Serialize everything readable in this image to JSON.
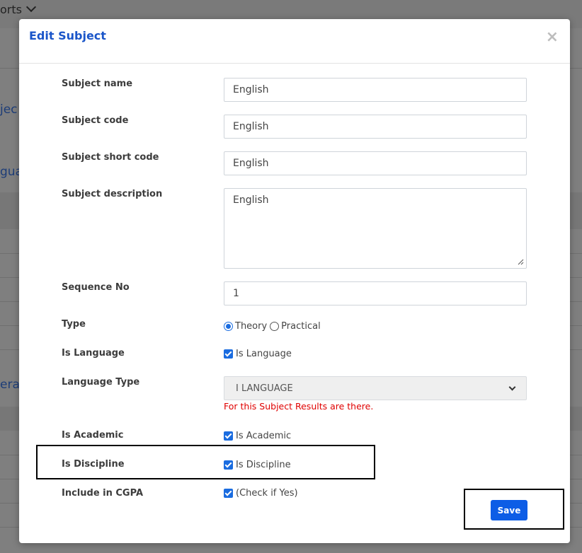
{
  "background": {
    "nav_text": "orts",
    "left_fragments": [
      "jec",
      "gua",
      "era"
    ]
  },
  "modal": {
    "title": "Edit Subject",
    "close_glyph": "×"
  },
  "form": {
    "subject_name": {
      "label": "Subject name",
      "value": "English"
    },
    "subject_code": {
      "label": "Subject code",
      "value": "English"
    },
    "subject_short_code": {
      "label": "Subject short code",
      "value": "English"
    },
    "subject_description": {
      "label": "Subject description",
      "value": "English"
    },
    "sequence_no": {
      "label": "Sequence No",
      "value": "1"
    },
    "type": {
      "label": "Type",
      "options": [
        "Theory",
        "Practical"
      ],
      "selected": "Theory"
    },
    "is_language": {
      "label": "Is Language",
      "checkbox_label": "Is Language",
      "checked": true
    },
    "language_type": {
      "label": "Language Type",
      "selected": "I LANGUAGE",
      "error": "For this Subject Results are there."
    },
    "is_academic": {
      "label": "Is Academic",
      "checkbox_label": "Is Academic",
      "checked": true
    },
    "is_discipline": {
      "label": "Is Discipline",
      "checkbox_label": "Is Discipline",
      "checked": true
    },
    "include_in_cgpa": {
      "label": "Include in CGPA",
      "checkbox_label": "(Check if Yes)",
      "checked": true
    }
  },
  "actions": {
    "save_label": "Save"
  },
  "colors": {
    "primary": "#0d5de6",
    "title": "#1a55c9",
    "error": "#e00000",
    "overlay": "#7f7f7f"
  }
}
